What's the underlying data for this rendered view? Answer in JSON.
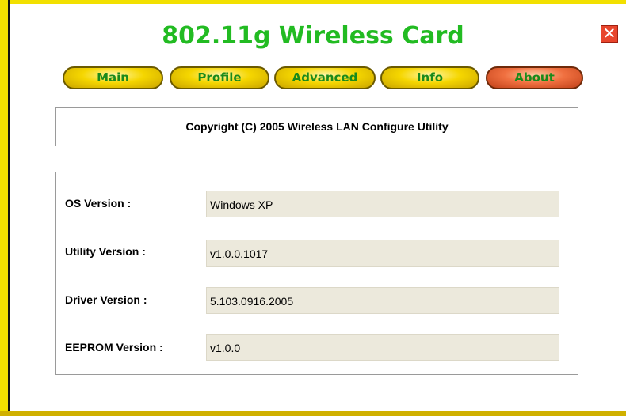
{
  "header": {
    "title": "802.11g Wireless Card",
    "close_glyph": "✕"
  },
  "tabs": [
    {
      "label": "Main",
      "active": false
    },
    {
      "label": "Profile",
      "active": false
    },
    {
      "label": "Advanced",
      "active": false
    },
    {
      "label": "Info",
      "active": false
    },
    {
      "label": "About",
      "active": true
    }
  ],
  "about": {
    "copyright": "Copyright (C) 2005  Wireless LAN Configure Utility",
    "fields": [
      {
        "label": "OS Version :",
        "value": "Windows XP"
      },
      {
        "label": "Utility Version :",
        "value": "v1.0.0.1017"
      },
      {
        "label": "Driver Version :",
        "value": "5.103.0916.2005"
      },
      {
        "label": "EEPROM Version :",
        "value": "v1.0.0"
      }
    ]
  },
  "colors": {
    "title": "#22bb22",
    "tab_yellow": "#f5d600",
    "tab_active": "#f07040",
    "frame": "#f2e000",
    "field_bg": "#ece9dc"
  }
}
